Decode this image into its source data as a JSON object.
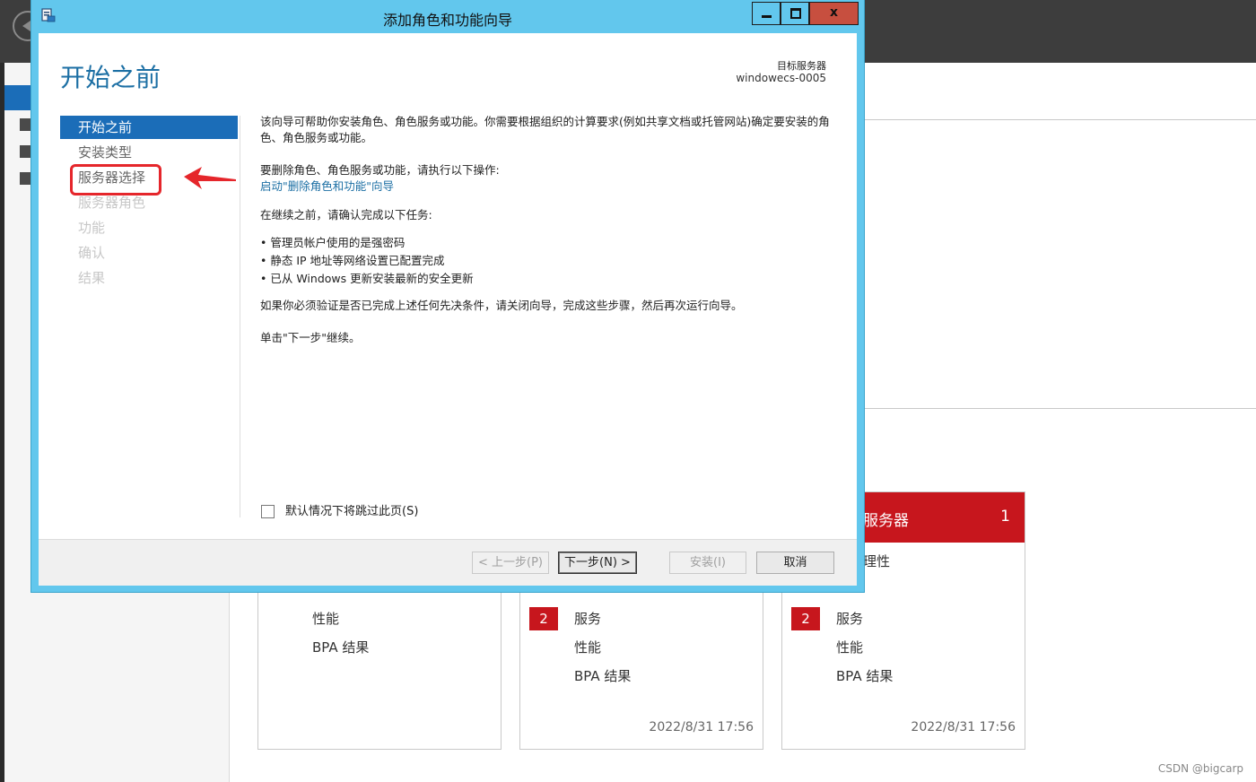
{
  "background": {
    "tiles": [
      {
        "partial_label": "…",
        "rows": [
          "性能",
          "BPA 结果"
        ]
      },
      {
        "partial_label": "…",
        "badge": "2",
        "rows": [
          "服务",
          "性能",
          "BPA 结果"
        ],
        "timestamp": "2022/8/31 17:56"
      },
      {
        "header_title": "服务器",
        "header_count": "1",
        "partial_label": "理性",
        "badge": "2",
        "rows": [
          "服务",
          "性能",
          "BPA 结果"
        ],
        "timestamp": "2022/8/31 17:56"
      }
    ],
    "watermark": "CSDN @bigcarp",
    "accent_color": "#c7161d"
  },
  "dialog": {
    "title": "添加角色和功能向导",
    "close_label": "x",
    "page_title": "开始之前",
    "target_server_label": "目标服务器",
    "target_server_value": "windowecs-0005",
    "nav": [
      {
        "label": "开始之前",
        "state": "active"
      },
      {
        "label": "安装类型",
        "state": "normal"
      },
      {
        "label": "服务器选择",
        "state": "normal"
      },
      {
        "label": "服务器角色",
        "state": "disabled"
      },
      {
        "label": "功能",
        "state": "disabled"
      },
      {
        "label": "确认",
        "state": "disabled"
      },
      {
        "label": "结果",
        "state": "disabled"
      }
    ],
    "content": {
      "intro": "该向导可帮助你安装角色、角色服务或功能。你需要根据组织的计算要求(例如共享文档或托管网站)确定要安装的角色、角色服务或功能。",
      "remove_heading": "要删除角色、角色服务或功能，请执行以下操作:",
      "remove_link": "启动\"删除角色和功能\"向导",
      "confirm_heading": "在继续之前，请确认完成以下任务:",
      "bullets": [
        "管理员帐户使用的是强密码",
        "静态 IP 地址等网络设置已配置完成",
        "已从 Windows 更新安装最新的安全更新"
      ],
      "prereq_note": "如果你必须验证是否已完成上述任何先决条件，请关闭向导，完成这些步骤，然后再次运行向导。",
      "next_hint": "单击\"下一步\"继续。"
    },
    "skip_checkbox_label": "默认情况下将跳过此页(S)",
    "buttons": {
      "previous": "< 上一步(P)",
      "next": "下一步(N) >",
      "install": "安装(I)",
      "cancel": "取消"
    },
    "accent_color": "#1b6db8",
    "frame_color": "#62c7ed"
  }
}
